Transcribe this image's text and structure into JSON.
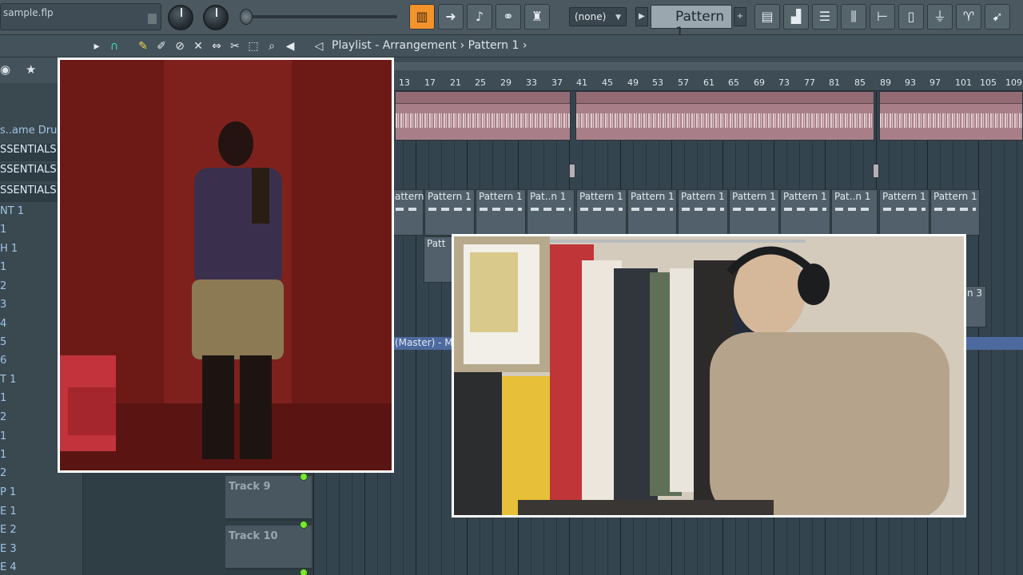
{
  "project": {
    "filename": "sample.flp"
  },
  "toolbar": {
    "channel_dropdown": "(none)",
    "pattern_name": "Pattern 1",
    "pattern_add": "+"
  },
  "subbar": {
    "breadcrumb_main": "Playlist - Arrangement",
    "breadcrumb_sep": "›",
    "breadcrumb_pattern": "Pattern 1"
  },
  "browser": {
    "items": [
      {
        "label": "s..ame Drum"
      },
      {
        "label": "SSENTIALS"
      },
      {
        "label": "SSENTIALS"
      },
      {
        "label": "SSENTIALS"
      },
      {
        "label": "NT 1"
      },
      {
        "label": "1"
      },
      {
        "label": "H 1"
      },
      {
        "label": "1"
      },
      {
        "label": "2"
      },
      {
        "label": "3"
      },
      {
        "label": "4"
      },
      {
        "label": "5"
      },
      {
        "label": "6"
      },
      {
        "label": "T 1"
      },
      {
        "label": "1"
      },
      {
        "label": "2"
      },
      {
        "label": "1"
      },
      {
        "label": "1"
      },
      {
        "label": "2"
      },
      {
        "label": "P 1"
      },
      {
        "label": "E 1"
      },
      {
        "label": "E 2"
      },
      {
        "label": "E 3"
      },
      {
        "label": "E 4"
      }
    ]
  },
  "ruler": {
    "bars": [
      "13",
      "17",
      "21",
      "25",
      "29",
      "33",
      "37",
      "41",
      "45",
      "49",
      "53",
      "57",
      "61",
      "65",
      "69",
      "73",
      "77",
      "81",
      "85",
      "89",
      "93",
      "97",
      "101",
      "105",
      "109"
    ]
  },
  "clips": {
    "patterns": [
      {
        "label": "attern 1"
      },
      {
        "label": "Pattern 1"
      },
      {
        "label": "Pattern 1"
      },
      {
        "label": "Pat..n 1"
      },
      {
        "label": "Pattern 1"
      },
      {
        "label": "Pattern 1"
      },
      {
        "label": "Pattern 1"
      },
      {
        "label": "Pattern 1"
      },
      {
        "label": "Pattern 1"
      },
      {
        "label": "Pat..n 1"
      },
      {
        "label": "Pattern 1"
      },
      {
        "label": "Pattern 1"
      }
    ],
    "lower_pattern": "Patt",
    "right_pattern": "n 3",
    "master_label": "(Master) - Mi"
  },
  "tracks": [
    {
      "label": "Track 9"
    },
    {
      "label": "Track 10"
    }
  ],
  "colors": {
    "accent_orange": "#f4922b",
    "audio_clip": "#a87f88",
    "pattern_clip": "#51606a",
    "master_bar": "#4d6aa0",
    "led_green": "#76ea2e"
  }
}
